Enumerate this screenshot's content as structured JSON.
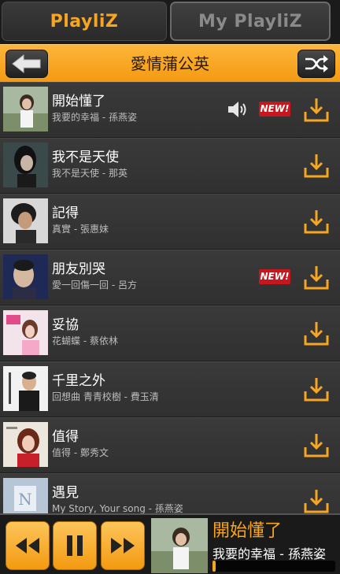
{
  "tabs": {
    "active_label": "PlayliZ",
    "inactive_label": "My PlayliZ"
  },
  "header": {
    "title": "愛情蒲公英",
    "back_icon": "arrow-left-icon",
    "shuffle_icon": "shuffle-icon"
  },
  "songs": [
    {
      "title": "開始懂了",
      "subtitle": "我要的幸福 - 孫燕姿",
      "new": true,
      "playing": true,
      "new_label": "NEW!"
    },
    {
      "title": "我不是天使",
      "subtitle": "我不是天使 - 那英",
      "new": false,
      "playing": false
    },
    {
      "title": "記得",
      "subtitle": "真實 - 張惠妹",
      "new": false,
      "playing": false
    },
    {
      "title": "朋友別哭",
      "subtitle": "愛一回傷一回 - 呂方",
      "new": true,
      "playing": false,
      "new_label": "NEW!"
    },
    {
      "title": "妥協",
      "subtitle": "花蝴蝶 - 蔡依林",
      "new": false,
      "playing": false
    },
    {
      "title": "千里之外",
      "subtitle": "回想曲 青青校樹 - 費玉清",
      "new": false,
      "playing": false
    },
    {
      "title": "值得",
      "subtitle": "值得 - 鄭秀文",
      "new": false,
      "playing": false
    },
    {
      "title": "遇見",
      "subtitle": "My Story, Your song - 孫燕姿",
      "new": false,
      "playing": false
    }
  ],
  "player": {
    "title": "開始懂了",
    "subtitle": "我要的幸福 - 孫燕姿",
    "progress": 0.02,
    "controls": [
      "rewind-icon",
      "pause-icon",
      "fast-forward-icon"
    ]
  },
  "colors": {
    "accent": "#f6a623",
    "new_badge": "#c8161e"
  }
}
